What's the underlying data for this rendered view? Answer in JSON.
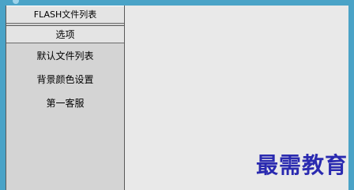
{
  "sidebar": {
    "sections": [
      {
        "label": "FLASH文件列表"
      },
      {
        "label": "选项"
      }
    ],
    "items": [
      {
        "label": "默认文件列表"
      },
      {
        "label": "背景颜色设置"
      },
      {
        "label": "第一客服"
      }
    ]
  },
  "watermark": {
    "text": "最需教育"
  }
}
